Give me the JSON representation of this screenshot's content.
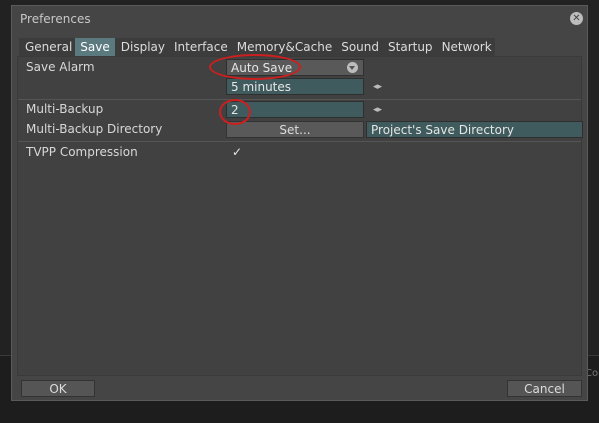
{
  "dialog": {
    "title": "Preferences",
    "close_glyph": "✕"
  },
  "tabs": [
    {
      "label": "General",
      "active": false
    },
    {
      "label": "Save",
      "active": true
    },
    {
      "label": "Display",
      "active": false
    },
    {
      "label": "Interface",
      "active": false
    },
    {
      "label": "Memory&Cache",
      "active": false
    },
    {
      "label": "Sound",
      "active": false
    },
    {
      "label": "Startup",
      "active": false
    },
    {
      "label": "Network",
      "active": false
    }
  ],
  "save": {
    "save_alarm_label": "Save Alarm",
    "save_alarm_mode": "Auto Save",
    "save_alarm_interval": "5 minutes",
    "multi_backup_label": "Multi-Backup",
    "multi_backup_value": "2",
    "multi_backup_dir_label": "Multi-Backup Directory",
    "set_button_label": "Set...",
    "multi_backup_dir_value": "Project's Save Directory",
    "tvpp_label": "TVPP Compression",
    "tvpp_checked": true
  },
  "footer": {
    "ok_label": "OK",
    "cancel_label": "Cancel"
  },
  "background": {
    "corner_text": "Co"
  },
  "colors": {
    "field_teal": "#3f5b5d",
    "active_tab": "#5b7a80",
    "annotation_red": "#cc1f1f"
  }
}
